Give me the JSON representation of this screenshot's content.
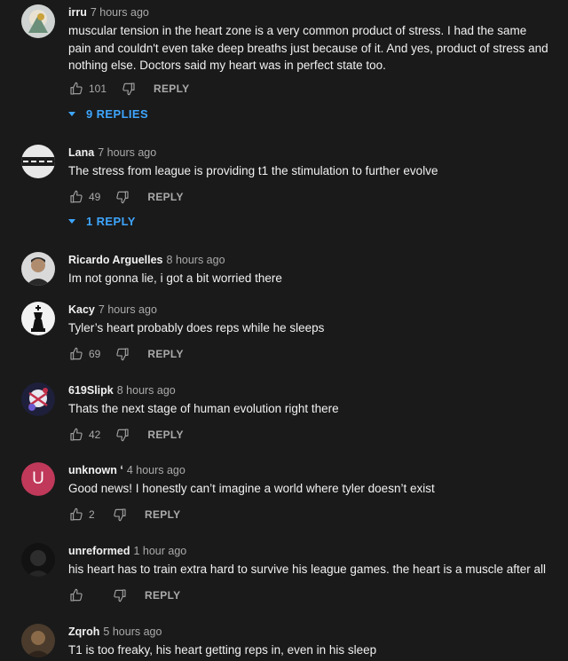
{
  "comments": [
    {
      "author": "irru",
      "time": "7 hours ago",
      "text": "muscular tension in the heart zone is a very common product of stress. I had the same pain and couldn't even take deep breaths just because of it. And yes, product of stress and nothing else. Doctors said my heart was in perfect state too.",
      "likes": "101",
      "reply_label": "REPLY",
      "replies_label": "9 REPLIES"
    },
    {
      "author": "Lana",
      "time": "7 hours ago",
      "text": "The stress from league is providing t1 the stimulation to further evolve",
      "likes": "49",
      "reply_label": "REPLY",
      "replies_label": "1 REPLY"
    },
    {
      "author": "Ricardo Arguelles",
      "time": "8 hours ago",
      "text": "Im not gonna lie, i got a bit worried there"
    },
    {
      "author": "Kacy",
      "time": "7 hours ago",
      "text": "Tyler’s heart probably does reps while he sleeps",
      "likes": "69",
      "reply_label": "REPLY"
    },
    {
      "author": "619Slipk",
      "time": "8 hours ago",
      "text": "Thats the next stage of human evolution right there",
      "likes": "42",
      "reply_label": "REPLY"
    },
    {
      "author": "unknown ʻ",
      "time": "4 hours ago",
      "avatar_letter": "U",
      "text": "Good news! I honestly can’t imagine a world where tyler doesn’t exist",
      "likes": "2",
      "reply_label": "REPLY"
    },
    {
      "author": "unreformed",
      "time": "1 hour ago",
      "text": "his heart has to train extra hard to survive his league games. the heart is a muscle after all",
      "likes": "",
      "reply_label": "REPLY"
    },
    {
      "author": "Zqroh",
      "time": "5 hours ago",
      "text": "T1 is too freaky, his heart getting reps in, even in his sleep"
    }
  ],
  "icons": {
    "like": "thumbs-up-icon",
    "dislike": "thumbs-down-icon",
    "expand": "caret-down-icon"
  },
  "colors": {
    "background": "#1a1a1a",
    "link": "#3ea6ff",
    "secondary": "#aaaaaa",
    "avatar_u": "#c0395a"
  }
}
